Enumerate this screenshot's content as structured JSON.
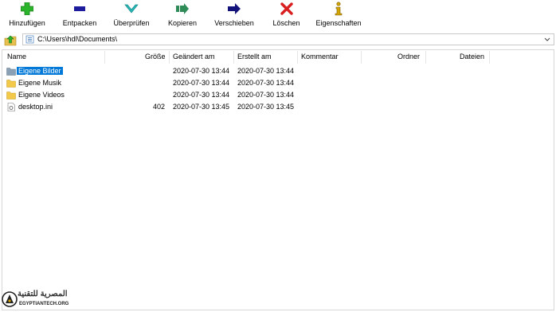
{
  "toolbar": {
    "add": "Hinzufügen",
    "extract": "Entpacken",
    "test": "Überprüfen",
    "copy": "Kopieren",
    "move": "Verschieben",
    "delete": "Löschen",
    "info": "Eigenschaften"
  },
  "address": {
    "path": "C:\\Users\\hdl\\Documents\\"
  },
  "columns": {
    "name": "Name",
    "size": "Größe",
    "modified": "Geändert am",
    "created": "Erstellt am",
    "comment": "Kommentar",
    "folders": "Ordner",
    "files": "Dateien"
  },
  "rows": [
    {
      "name": "Eigene Bilder",
      "size": "",
      "modified": "2020-07-30 13:44",
      "created": "2020-07-30 13:44",
      "icon": "folder-shortcut-icon",
      "selected": true
    },
    {
      "name": "Eigene Musik",
      "size": "",
      "modified": "2020-07-30 13:44",
      "created": "2020-07-30 13:44",
      "icon": "folder-icon",
      "selected": false
    },
    {
      "name": "Eigene Videos",
      "size": "",
      "modified": "2020-07-30 13:44",
      "created": "2020-07-30 13:44",
      "icon": "folder-icon",
      "selected": false
    },
    {
      "name": "desktop.ini",
      "size": "402",
      "modified": "2020-07-30 13:45",
      "created": "2020-07-30 13:45",
      "icon": "settings-file-icon",
      "selected": false
    }
  ],
  "watermark": {
    "arabic": "المصرية للتقنية",
    "english": "EGYPTIANTECH.ORG"
  },
  "colors": {
    "selection": "#0078d7",
    "add": "#2bb52b",
    "extract": "#1c1c9c",
    "test": "#26b8b8",
    "copy": "#2e8b57",
    "move": "#12127a",
    "delete": "#d81e1e",
    "info": "#d4a500"
  }
}
